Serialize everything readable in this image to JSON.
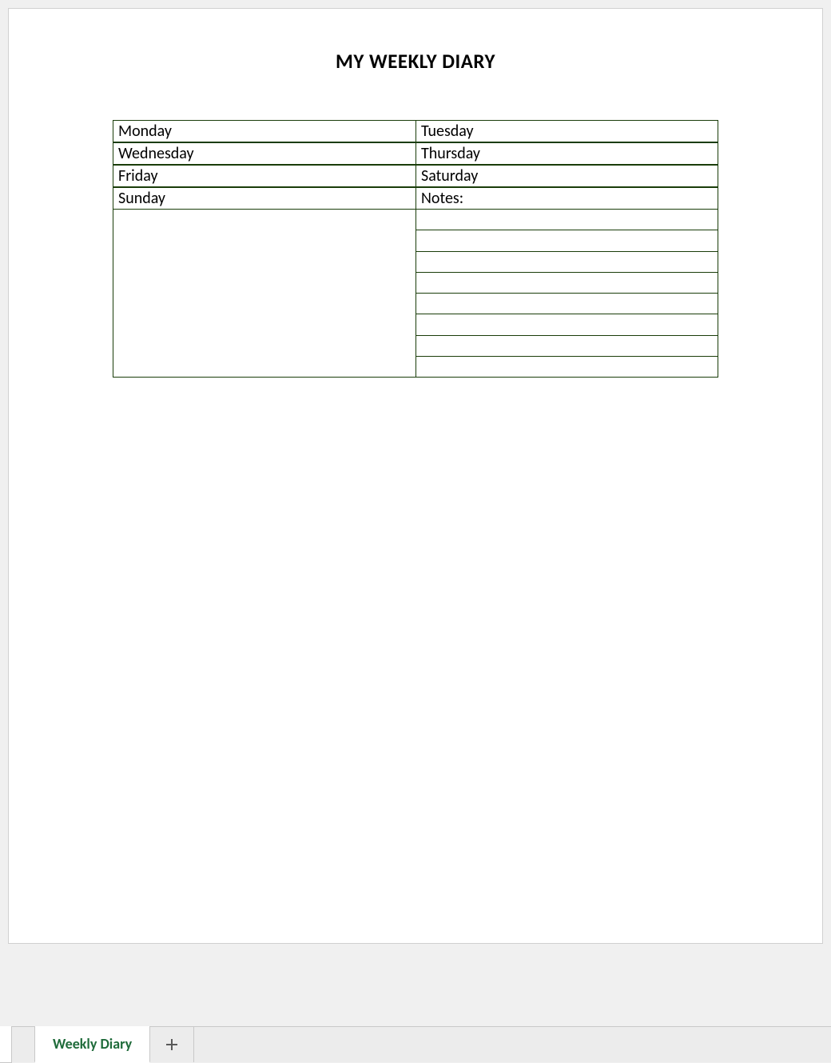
{
  "title": "MY WEEKLY DIARY",
  "days": {
    "monday": "Monday",
    "tuesday": "Tuesday",
    "wednesday": "Wednesday",
    "thursday": "Thursday",
    "friday": "Friday",
    "saturday": "Saturday",
    "sunday": "Sunday",
    "notes": "Notes:"
  },
  "notes_line_count": 8,
  "tabs": {
    "active": "Weekly Diary"
  }
}
